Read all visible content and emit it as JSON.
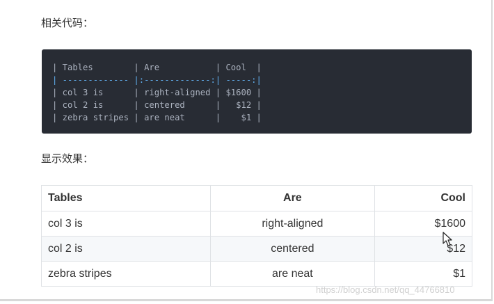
{
  "headings": {
    "code_label": "相关代码：",
    "result_label": "显示效果："
  },
  "code_lines": [
    "| Tables        | Are           | Cool  |",
    "| ------------- |:-------------:| -----:|",
    "| col 3 is      | right-aligned | $1600 |",
    "| col 2 is      | centered      |   $12 |",
    "| zebra stripes | are neat      |    $1 |"
  ],
  "table": {
    "headers": [
      "Tables",
      "Are",
      "Cool"
    ],
    "rows": [
      [
        "col 3 is",
        "right-aligned",
        "$1600"
      ],
      [
        "col 2 is",
        "centered",
        "$12"
      ],
      [
        "zebra stripes",
        "are neat",
        "$1"
      ]
    ]
  },
  "watermark": "https://blog.csdn.net/qq_44766810",
  "colors": {
    "code_bg": "#282c34",
    "code_text": "#abb2bf",
    "code_separator": "#61afef",
    "stripe_bg": "#f6f8fa",
    "table_border": "#dfe2e5"
  }
}
